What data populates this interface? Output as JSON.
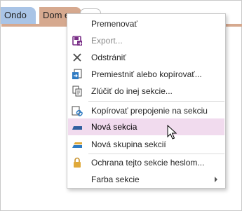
{
  "tabs": [
    {
      "label": "Ondo"
    },
    {
      "label": "Dom e"
    }
  ],
  "menu": {
    "items": [
      {
        "label": "Premenovať",
        "icon": "none",
        "disabled": false
      },
      {
        "label": "Export...",
        "icon": "export-icon",
        "disabled": true
      },
      {
        "label": "Odstrániť",
        "icon": "delete-x-icon",
        "disabled": false
      },
      {
        "label": "Premiestniť alebo kopírovať...",
        "icon": "move-copy-icon",
        "disabled": false
      },
      {
        "label": "Zlúčiť do inej sekcie...",
        "icon": "merge-icon",
        "disabled": false
      },
      {
        "label": "Kopírovať prepojenie na sekciu",
        "icon": "link-icon",
        "disabled": false
      },
      {
        "label": "Nová sekcia",
        "icon": "new-section-icon",
        "disabled": false,
        "hover": true
      },
      {
        "label": "Nová skupina sekcií",
        "icon": "new-section-group-icon",
        "disabled": false
      },
      {
        "label": "Ochrana tejto sekcie heslom...",
        "icon": "lock-icon",
        "disabled": false
      },
      {
        "label": "Farba sekcie",
        "icon": "none",
        "disabled": false,
        "submenu": true
      }
    ]
  },
  "colors": {
    "tab_blue": "#a9c4e6",
    "tab_active": "#d6a98f",
    "hover_highlight": "#f1dbee",
    "icon_purple": "#7a2f87",
    "icon_blue": "#2f7bc3",
    "icon_gold": "#e0a93a"
  }
}
